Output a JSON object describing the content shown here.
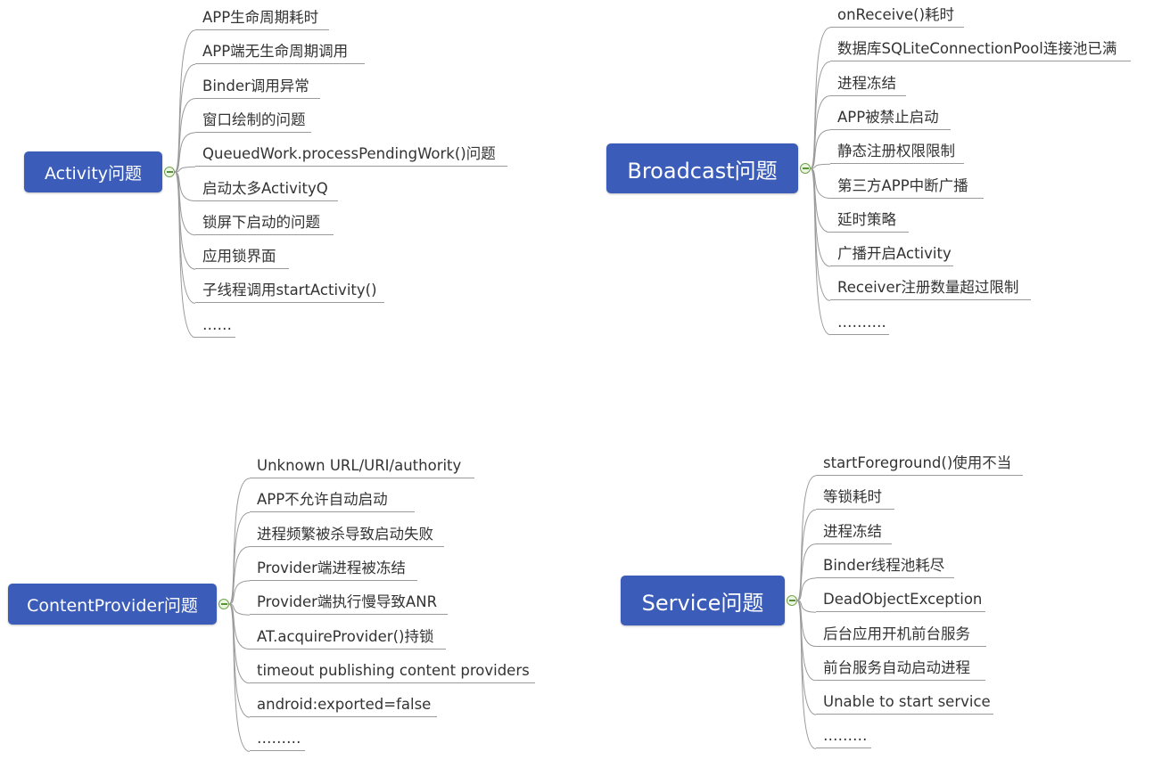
{
  "colors": {
    "node_fill": "#3b5cb8",
    "node_text": "#ffffff",
    "leaf_text": "#333333",
    "line": "#9a9a9a",
    "collapse_fill": "#eaf6e0",
    "collapse_border": "#6fa14a"
  },
  "diagrams": [
    {
      "root_label": "Activity问题",
      "items": [
        "APP生命周期耗时",
        "APP端无生命周期调用",
        "Binder调用异常",
        "窗口绘制的问题",
        "QueuedWork.processPendingWork()问题",
        "启动太多ActivityQ",
        "锁屏下启动的问题",
        "应用锁界面",
        "子线程调用startActivity()",
        "……"
      ]
    },
    {
      "root_label": "Broadcast问题",
      "items": [
        "onReceive()耗时",
        "数据库SQLiteConnectionPool连接池已满",
        "进程冻结",
        "APP被禁止启动",
        "静态注册权限限制",
        "第三方APP中断广播",
        "延时策略",
        "广播开启Activity",
        "Receiver注册数量超过限制",
        "………."
      ]
    },
    {
      "root_label": "ContentProvider问题",
      "items": [
        "Unknown URL/URI/authority",
        "APP不允许自动启动",
        "进程频繁被杀导致启动失败",
        "Provider端进程被冻结",
        "Provider端执行慢导致ANR",
        "AT.acquireProvider()持锁",
        "timeout publishing content providers",
        "android:exported=false",
        "………"
      ]
    },
    {
      "root_label": "Service问题",
      "items": [
        "startForeground()使用不当",
        "等锁耗时",
        "进程冻结",
        "Binder线程池耗尽",
        "DeadObjectException",
        "后台应用开机前台服务",
        "前台服务自动启动进程",
        "Unable to start service",
        "………"
      ]
    }
  ]
}
